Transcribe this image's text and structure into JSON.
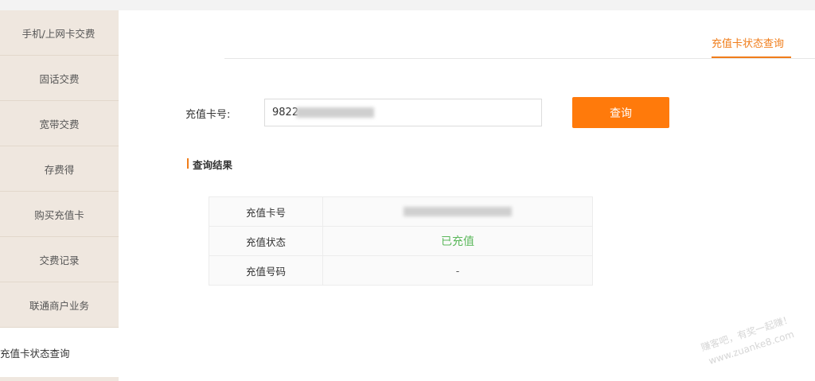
{
  "sidebar": {
    "items": [
      {
        "label": "手机/上网卡交费"
      },
      {
        "label": "固话交费"
      },
      {
        "label": "宽带交费"
      },
      {
        "label": "存费得"
      },
      {
        "label": "购买充值卡"
      },
      {
        "label": "交费记录"
      },
      {
        "label": "联通商户业务"
      },
      {
        "label": "充值卡状态查询",
        "active": true
      }
    ]
  },
  "tabs": [
    {
      "label": "充值卡状态查询",
      "active": true
    }
  ],
  "form": {
    "card_label": "充值卡号:",
    "card_value": "9822",
    "query_button": "查询"
  },
  "result": {
    "title": "查询结果",
    "rows": [
      {
        "key": "充值卡号",
        "value": ""
      },
      {
        "key": "充值状态",
        "value": "已充值"
      },
      {
        "key": "充值号码",
        "value": "-"
      }
    ]
  },
  "watermark": {
    "line1": "赚客吧，有奖一起赚！",
    "line2": "www.zuanke8.com"
  },
  "colors": {
    "accent": "#f07d1a",
    "button": "#ff7a0b",
    "success": "#5cb85c",
    "sidebar": "#efe7df"
  }
}
